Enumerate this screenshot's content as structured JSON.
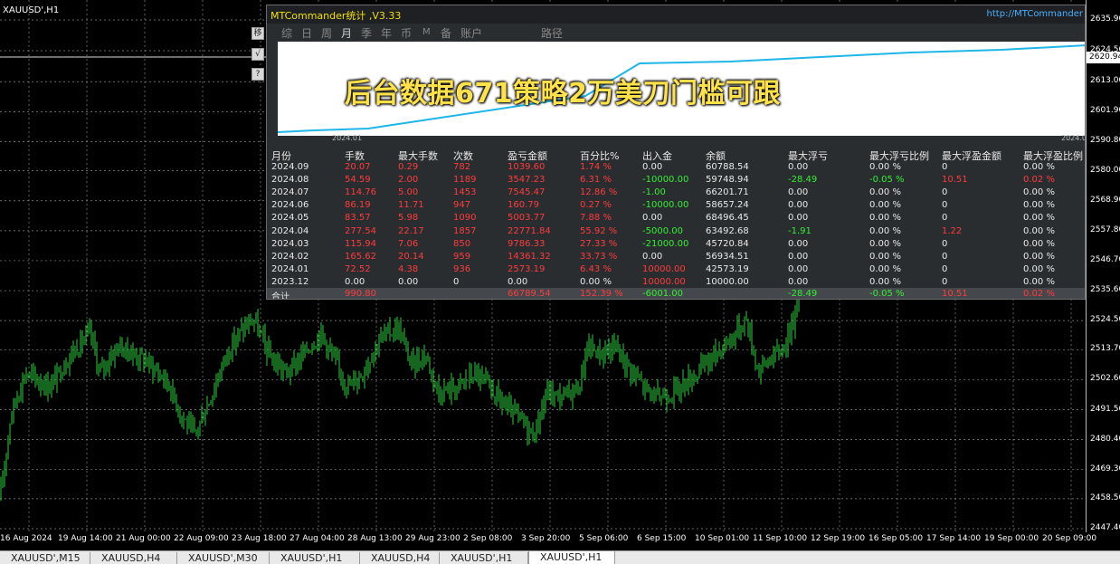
{
  "chart": {
    "symbol_label": "XAUUSD',H1",
    "price_ticks": [
      "2635.90",
      "2624.50",
      "2613.00",
      "2601.90",
      "2590.80",
      "2580.00",
      "2568.90",
      "2557.80",
      "2546.70",
      "2535.60",
      "2524.50",
      "2513.70",
      "2502.60",
      "2491.50",
      "2480.40",
      "2469.30",
      "2458.50",
      "2447.40"
    ],
    "current_price": "2620.94",
    "time_ticks": [
      "16 Aug 2024",
      "19 Aug 14:00",
      "21 Aug 00:00",
      "22 Aug 09:00",
      "23 Aug 18:00",
      "27 Aug 04:00",
      "28 Aug 13:00",
      "29 Aug 23:00",
      "2 Sep 08:00",
      "3 Sep 20:00",
      "5 Sep 06:00",
      "6 Sep 15:00",
      "10 Sep 01:00",
      "11 Sep 10:00",
      "12 Sep 19:00",
      "16 Sep 05:00",
      "17 Sep 14:00",
      "19 Sep 00:00",
      "20 Sep 09:00"
    ],
    "candle_color": "#2ecc40",
    "grid_color": "#8a8a8a"
  },
  "side_buttons": [
    "移",
    "√",
    "?"
  ],
  "tabs": [
    "XAUUSD',M15",
    "XAUUSD,H4",
    "XAUUSD',M30",
    "XAUUSD',H1",
    "XAUUSD,H4",
    "XAUUSD',H1",
    "XAUUSD',H1"
  ],
  "panel": {
    "title": "MTCommander统计 ,V3.33",
    "url": "http://MTCommander",
    "nav": [
      "综",
      "日",
      "周",
      "月",
      "季",
      "年",
      "币",
      "M",
      "备",
      "账户",
      "路径"
    ],
    "equity_dates": [
      "2024.01",
      "2024.0"
    ],
    "overlay": "后台数据671策略2万美刀门槛可跟",
    "headers": [
      "月份",
      "手数",
      "最大手数",
      "次数",
      "盈亏金额",
      "百分比%",
      "出入金",
      "余额",
      "最大浮亏",
      "最大浮亏比例",
      "最大浮盈金额",
      "最大浮盈比例"
    ],
    "rows": [
      [
        "2024.09",
        "20.07",
        "0.29",
        "782",
        "1039.60",
        "1.74 %",
        "0.00",
        "60788.54",
        "0.00",
        "0.00 %",
        "0",
        "0.00 %"
      ],
      [
        "2024.08",
        "54.59",
        "2.00",
        "1189",
        "3547.23",
        "6.31 %",
        "-10000.00",
        "59748.94",
        "-28.49",
        "-0.05 %",
        "10.51",
        "0.02 %"
      ],
      [
        "2024.07",
        "114.76",
        "5.00",
        "1453",
        "7545.47",
        "12.86 %",
        "-1.00",
        "66201.71",
        "0.00",
        "0.00 %",
        "0",
        "0.00 %"
      ],
      [
        "2024.06",
        "86.19",
        "11.71",
        "947",
        "160.79",
        "0.27 %",
        "-10000.00",
        "58657.24",
        "0.00",
        "0.00 %",
        "0",
        "0.00 %"
      ],
      [
        "2024.05",
        "83.57",
        "5.98",
        "1090",
        "5003.77",
        "7.88 %",
        "0.00",
        "68496.45",
        "0.00",
        "0.00 %",
        "0",
        "0.00 %"
      ],
      [
        "2024.04",
        "277.54",
        "22.17",
        "1857",
        "22771.84",
        "55.92 %",
        "-5000.00",
        "63492.68",
        "-1.91",
        "0.00 %",
        "1.22",
        "0.00 %"
      ],
      [
        "2024.03",
        "115.94",
        "7.06",
        "850",
        "9786.33",
        "27.33 %",
        "-21000.00",
        "45720.84",
        "0.00",
        "0.00 %",
        "0",
        "0.00 %"
      ],
      [
        "2024.02",
        "165.62",
        "20.14",
        "959",
        "14361.32",
        "33.73 %",
        "0.00",
        "56934.51",
        "0.00",
        "0.00 %",
        "0",
        "0.00 %"
      ],
      [
        "2024.01",
        "72.52",
        "4.38",
        "936",
        "2573.19",
        "6.43 %",
        "10000.00",
        "42573.19",
        "0.00",
        "0.00 %",
        "0",
        "0.00 %"
      ],
      [
        "2023.12",
        "0.00",
        "0.00",
        "0",
        "0.00",
        "0.00 %",
        "10000.00",
        "10000.00",
        "0.00",
        "0.00 %",
        "0",
        "0.00 %"
      ]
    ],
    "total": [
      "合计",
      "990.80",
      "",
      "",
      "66789.54",
      "152.39 %",
      "-6001.00",
      "",
      "-28.49",
      "-0.05 %",
      "10.51",
      "0.02 %"
    ]
  }
}
